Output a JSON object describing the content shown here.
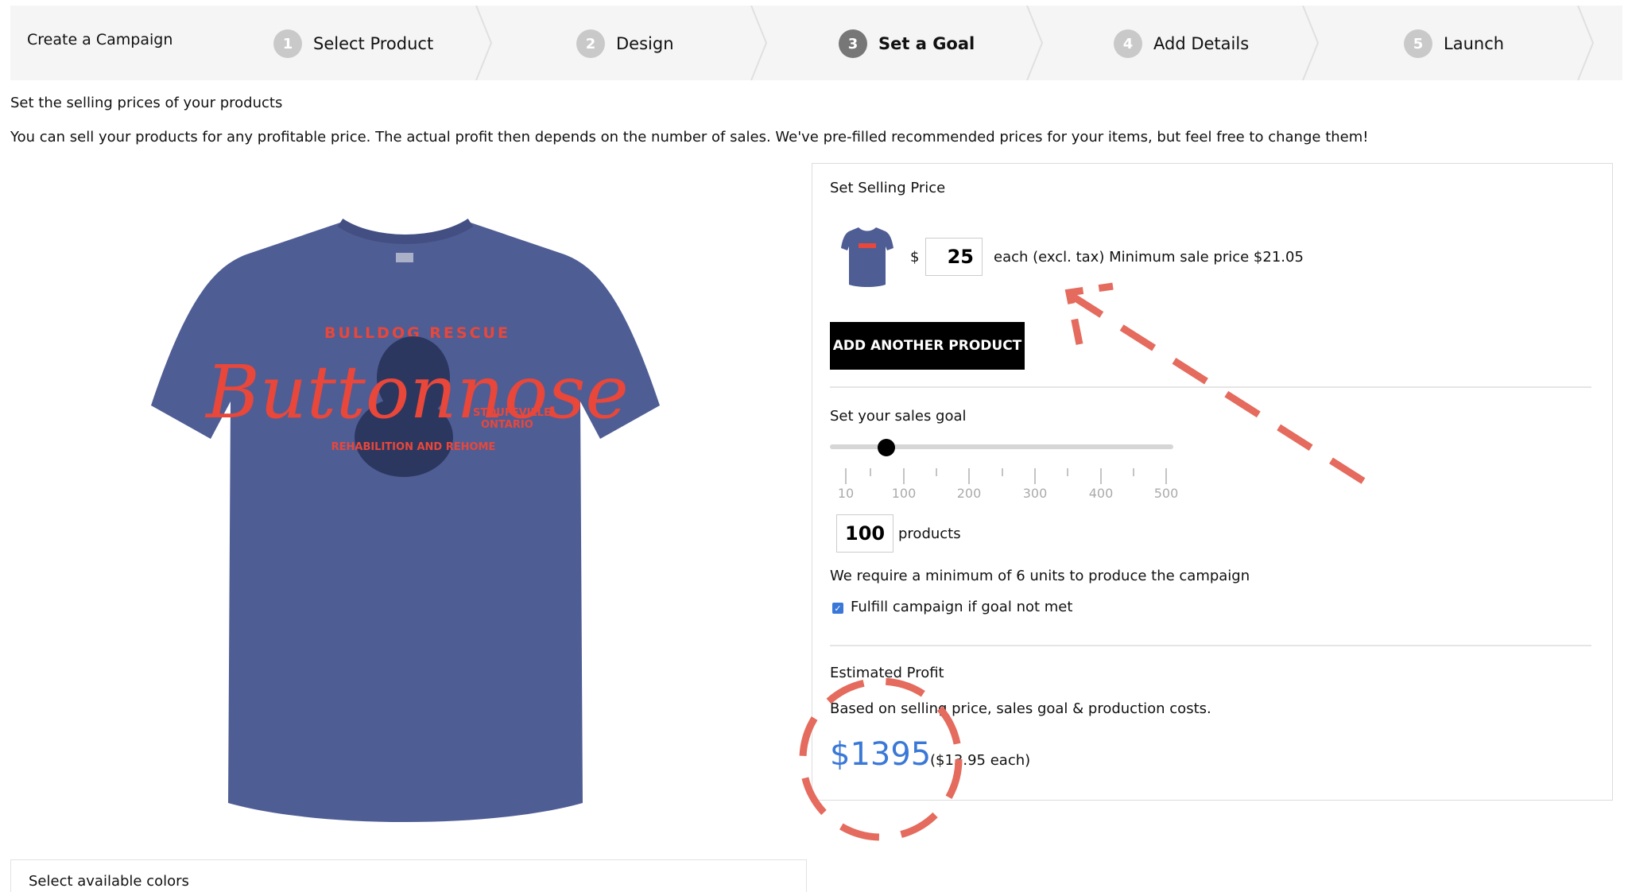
{
  "stepper": {
    "create_label": "Create a Campaign",
    "steps": [
      {
        "num": "1",
        "label": "Select Product"
      },
      {
        "num": "2",
        "label": "Design"
      },
      {
        "num": "3",
        "label": "Set a Goal"
      },
      {
        "num": "4",
        "label": "Add Details"
      },
      {
        "num": "5",
        "label": "Launch"
      }
    ],
    "active_step": 3
  },
  "intro": {
    "heading": "Set the selling prices of your products",
    "body": "You can sell your products for any profitable price. The actual profit then depends on the number of sales. We've pre-filled recommended prices for your items, but feel free to change them!"
  },
  "product": {
    "shirt_text_top": "BULLDOG RESCUE",
    "shirt_text_main": "Buttonnose",
    "shirt_text_loc1": "STOUFFVILLE",
    "shirt_text_loc2": "ONTARIO",
    "shirt_text_bottom": "REHABILITION AND REHOME"
  },
  "colors_panel": {
    "title": "Select available colors"
  },
  "pricing": {
    "title": "Set Selling Price",
    "currency": "$",
    "price_value": "25",
    "price_note": "each (excl. tax)  Minimum sale price $21.05",
    "add_button": "ADD ANOTHER PRODUCT"
  },
  "goal": {
    "title": "Set your sales goal",
    "slider_min": 10,
    "slider_max": 500,
    "slider_value": 100,
    "tick_labels": [
      "10",
      "100",
      "200",
      "300",
      "400",
      "500"
    ],
    "quantity_value": "100",
    "quantity_unit": "products",
    "min_note": "We require a minimum of 6 units to produce the campaign",
    "fulfill_label": "Fulfill campaign if goal not met",
    "fulfill_checked": true
  },
  "profit": {
    "title": "Estimated Profit",
    "basis": "Based on selling price, sales goal & production costs.",
    "value": "$1395",
    "each": "($13.95 each)"
  },
  "colors": {
    "shirt": "#4f5d95",
    "print": "#e8473a",
    "accent_blue": "#3a78d8",
    "annotation": "#e46b5d"
  }
}
